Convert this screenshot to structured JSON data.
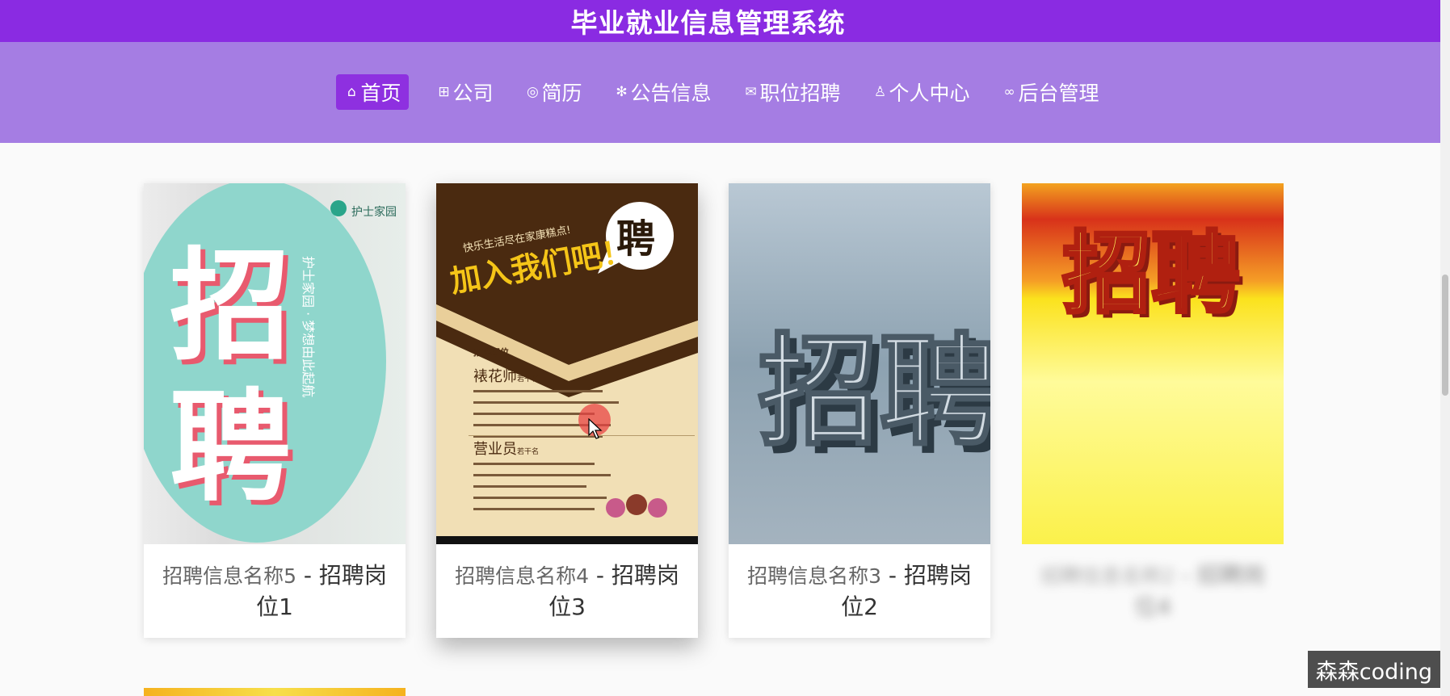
{
  "app": {
    "title": "毕业就业信息管理系统"
  },
  "nav": {
    "items": [
      {
        "icon": "home-icon",
        "label": "首页",
        "active": true
      },
      {
        "icon": "gift-icon",
        "label": "公司"
      },
      {
        "icon": "palette-icon",
        "label": "简历"
      },
      {
        "icon": "snowflake-icon",
        "label": "公告信息"
      },
      {
        "icon": "mail-icon",
        "label": "职位招聘"
      },
      {
        "icon": "user-icon",
        "label": "个人中心"
      },
      {
        "icon": "link-icon",
        "label": "后台管理"
      }
    ]
  },
  "cards": [
    {
      "name": "招聘信息名称5",
      "sep": " - ",
      "position": "招聘岗位1"
    },
    {
      "name": "招聘信息名称4",
      "sep": " - ",
      "position": "招聘岗位3"
    },
    {
      "name": "招聘信息名称3",
      "sep": " - ",
      "position": "招聘岗位2"
    },
    {
      "name": "招聘信息名称2",
      "sep": " - ",
      "position": "招聘岗位4"
    }
  ],
  "posters": {
    "p1": {
      "logo": "护士家园",
      "big_top": "招",
      "big_bottom": "聘",
      "side_text": "护士家园 · 梦想由此起航"
    },
    "p2": {
      "bubble": "聘",
      "slogan_small": "快乐生活尽在家康糕点!",
      "slogan_big": "加入我们吧！",
      "section": "招聘职位",
      "job1": "裱花师",
      "job1_count": "若干名",
      "job2": "营业员",
      "job2_count": "若干名"
    },
    "p3": {
      "big": "招聘"
    },
    "p4": {
      "big": "招聘"
    }
  },
  "watermark": "森森coding",
  "colors": {
    "topbar": "#8a2be2",
    "navband": "#a57de3",
    "active_tab": "#8e30e0"
  }
}
